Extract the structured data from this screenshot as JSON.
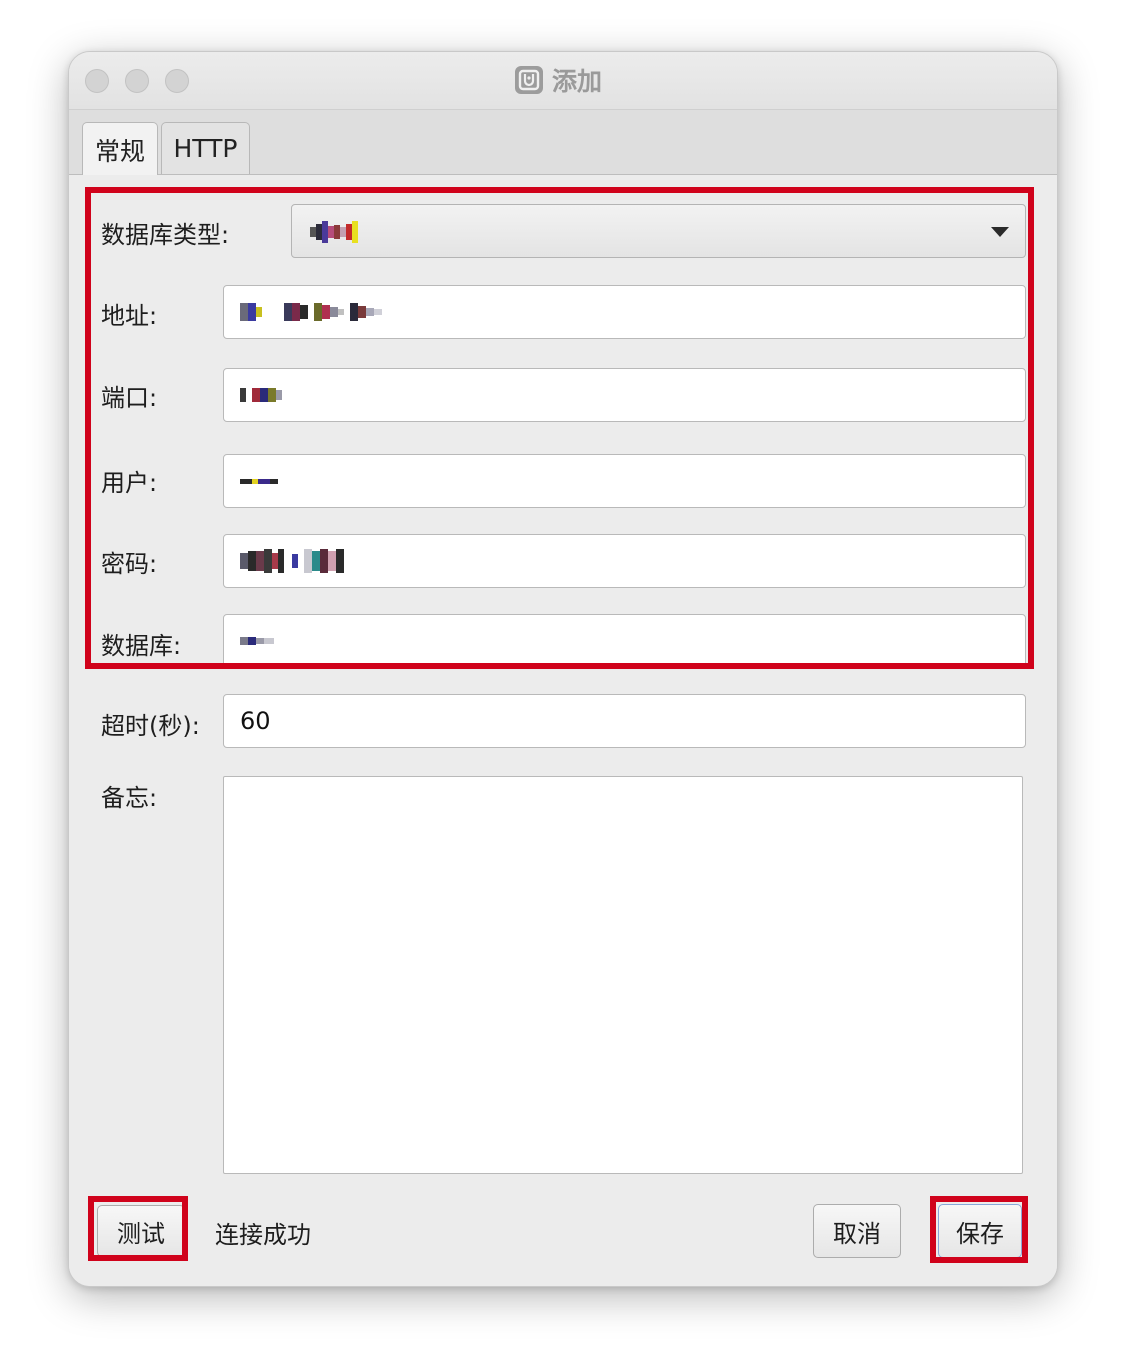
{
  "window": {
    "title": "添加",
    "icon": "database-app-icon"
  },
  "tabs": [
    {
      "label": "常规",
      "active": true
    },
    {
      "label": "HTTP",
      "active": false
    }
  ],
  "form": {
    "db_type_label": "数据库类型:",
    "address_label": "地址:",
    "port_label": "端口:",
    "user_label": "用户:",
    "password_label": "密码:",
    "database_label": "数据库:",
    "timeout_label": "超时(秒):",
    "timeout_value": "60",
    "memo_label": "备忘:"
  },
  "footer": {
    "test_button": "测试",
    "status_text": "连接成功",
    "cancel_button": "取消",
    "save_button": "保存"
  },
  "colors": {
    "highlight": "#d0021b",
    "window_bg": "#ececec"
  }
}
